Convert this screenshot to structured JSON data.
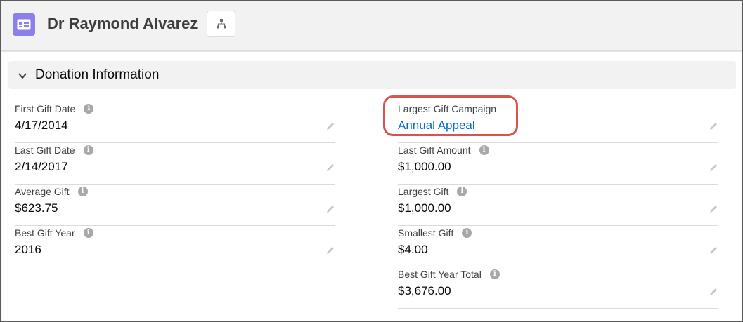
{
  "header": {
    "title": "Dr Raymond Alvarez",
    "record_icon": "contact-card-icon",
    "hierarchy_icon": "hierarchy-icon"
  },
  "section": {
    "title": "Donation Information",
    "expanded": true
  },
  "left_fields": [
    {
      "label": "First Gift Date",
      "value": "4/17/2014"
    },
    {
      "label": "Last Gift Date",
      "value": "2/14/2017"
    },
    {
      "label": "Average Gift",
      "value": "$623.75"
    },
    {
      "label": "Best Gift Year",
      "value": "2016"
    }
  ],
  "right_fields": [
    {
      "label": "Largest Gift Campaign",
      "value": "Annual Appeal",
      "is_link": true,
      "highlighted": true
    },
    {
      "label": "Last Gift Amount",
      "value": "$1,000.00"
    },
    {
      "label": "Largest Gift",
      "value": "$1,000.00"
    },
    {
      "label": "Smallest Gift",
      "value": "$4.00"
    },
    {
      "label": "Best Gift Year Total",
      "value": "$3,676.00"
    }
  ],
  "colors": {
    "record_icon_bg": "#8b7fe8",
    "link": "#006dcc",
    "highlight": "#d9534f"
  }
}
